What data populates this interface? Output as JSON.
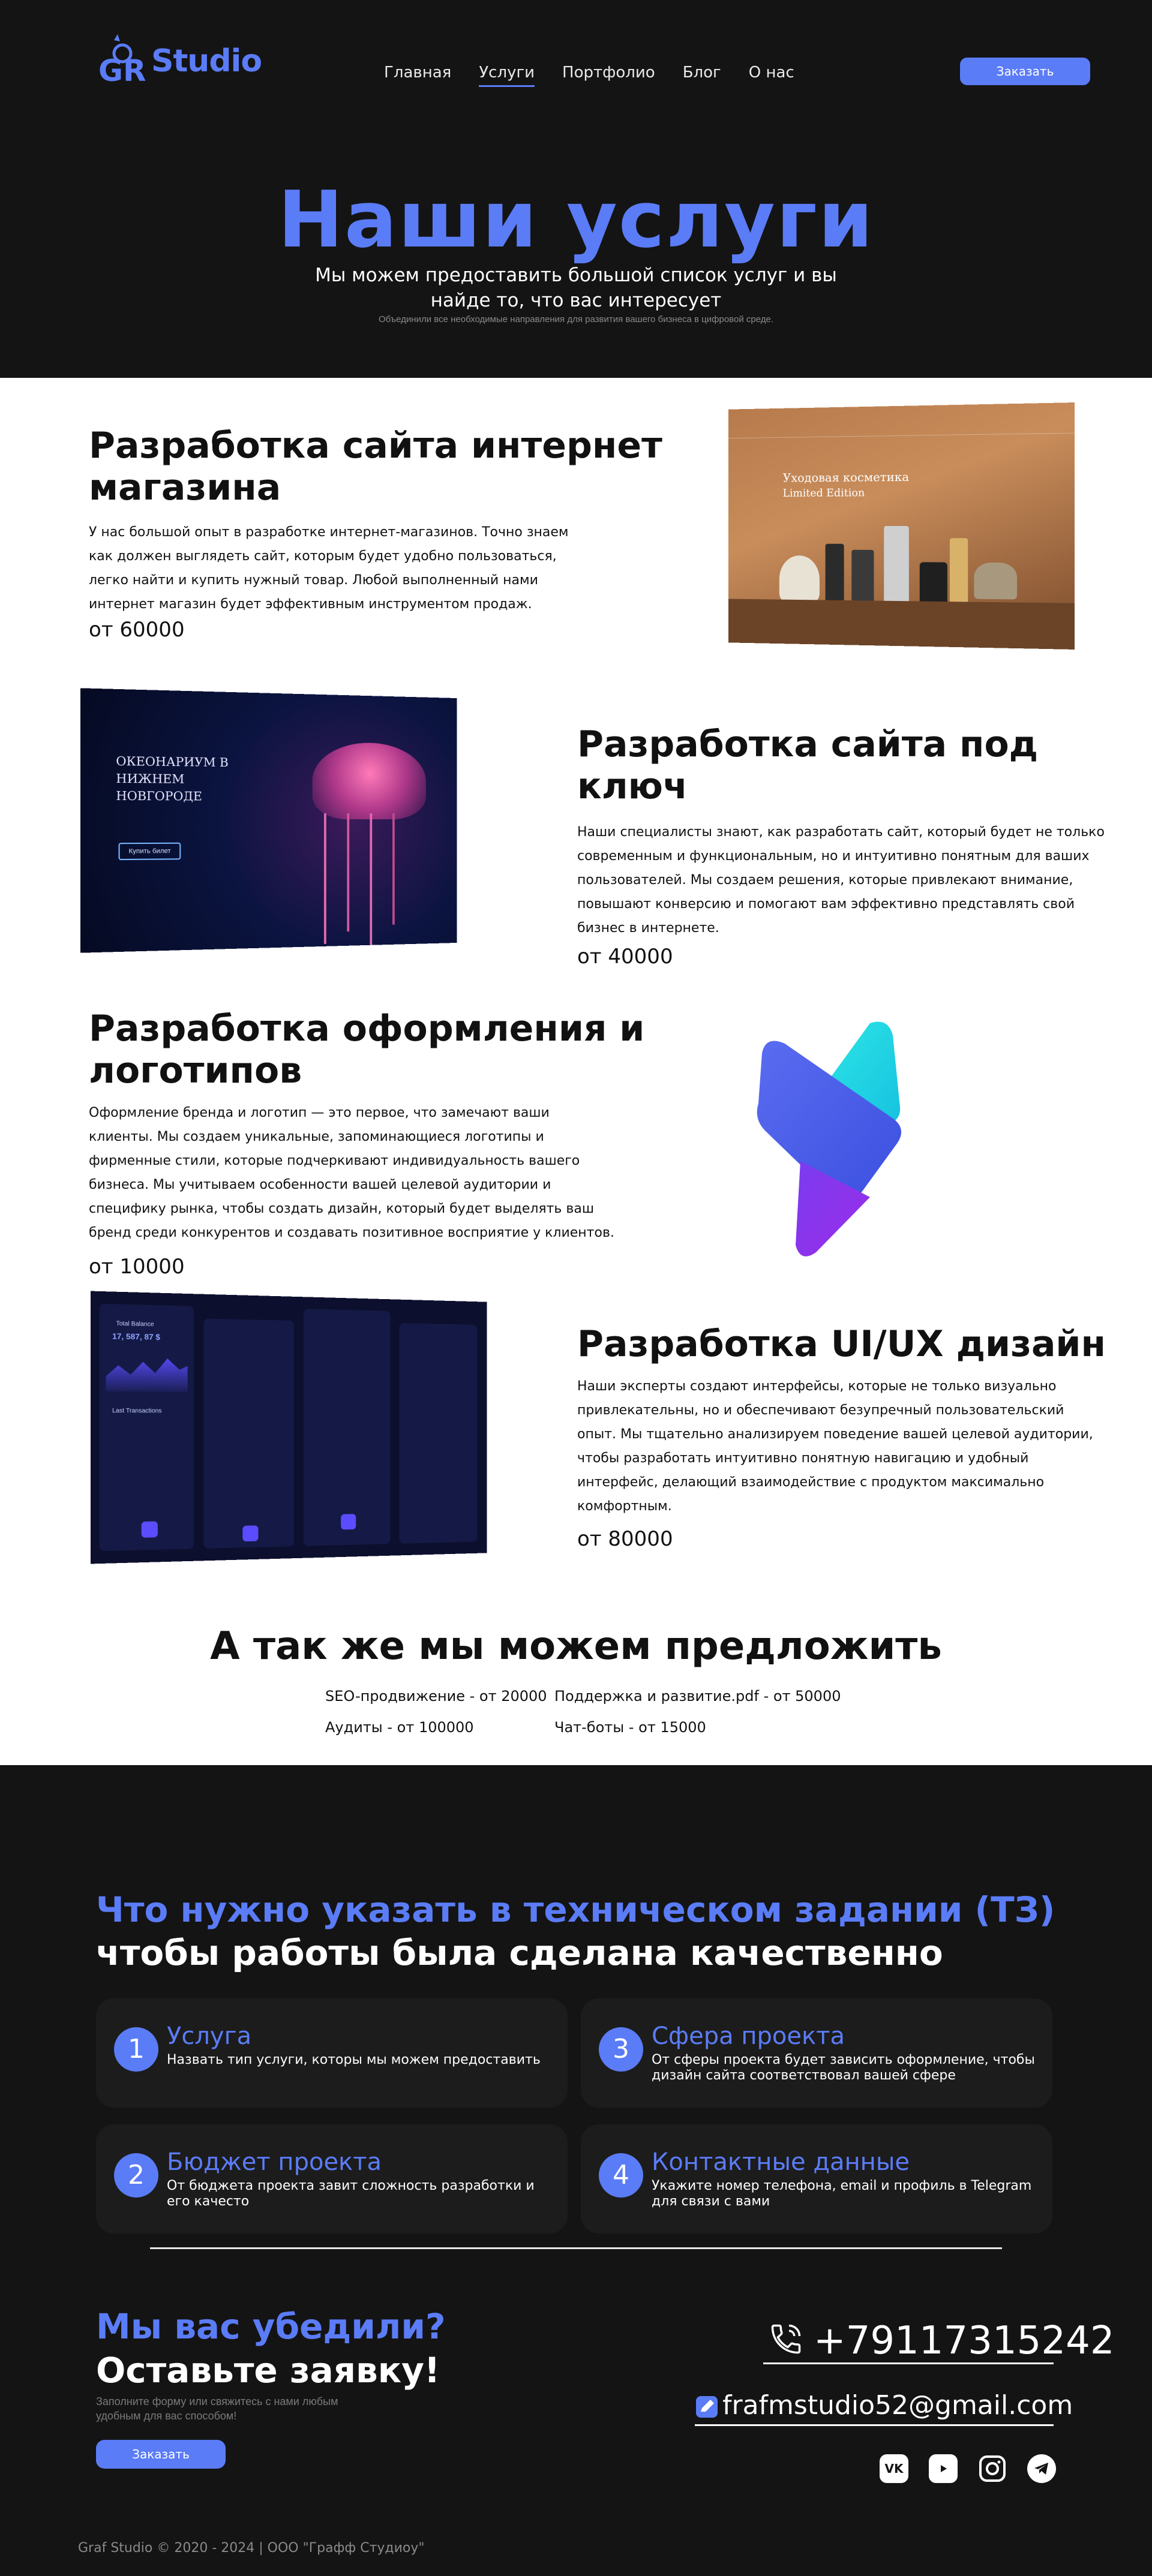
{
  "header": {
    "logo_text": "Studio",
    "logo_letters": "GR",
    "nav": [
      "Главная",
      "Услуги",
      "Портфолио",
      "Блог",
      "О нас"
    ],
    "order_label": "Заказать"
  },
  "hero": {
    "title": "Наши услуги",
    "subtitle": "Мы можем предоставить большой список услуг и вы найде то, что вас интересует",
    "note": "Объединили все необходимые направления для развития вашего бизнеса в цифровой среде."
  },
  "services": [
    {
      "title": "Разработка сайта интернет магазина",
      "description": "У нас большой опыт в разработке интернет-магазинов. Точно знаем как должен выглядеть сайт, которым будет удобно пользоваться, легко найти и купить нужный товар. Любой выполненный нами интернет магазин будет эффективным инструментом продаж.",
      "price": "от 60000"
    },
    {
      "title": "Разработка сайта под ключ",
      "description": "Наши специалисты знают, как разработать сайт, который будет не только современным и функциональным, но и интуитивно понятным для ваших пользователей. Мы создаем решения, которые привлекают внимание, повышают конверсию и помогают вам эффективно представлять свой бизнес в интернете.",
      "price": "от 40000"
    },
    {
      "title": "Разработка оформления и логотипов",
      "description": "Оформление бренда и логотип — это первое, что замечают ваши клиенты. Мы создаем уникальные, запоминающиеся логотипы и фирменные стили, которые подчеркивают индивидуальность вашего бизнеса. Мы учитываем особенности вашей целевой аудитории и специфику рынка, чтобы создать дизайн, который будет выделять ваш бренд среди конкурентов и создавать позитивное восприятие у клиентов.",
      "price": "от 10000"
    },
    {
      "title": "Разработка UI/UX дизайн",
      "description": "Наши эксперты создают интерфейсы, которые не только визуально привлекательны, но и обеспечивают безупречный пользовательский опыт. Мы тщательно анализируем поведение вашей целевой аудитории, чтобы разработать интуитивно понятную навигацию и удобный интерфейс, делающий взаимодействие с продуктом максимально комфортным.",
      "price": "от 80000"
    }
  ],
  "mockups": {
    "shop_heading": "Уходовая косметика",
    "shop_sub": "Limited Edition",
    "jelly_heading": "ОКЕОНАРИУМ В НИЖНЕМ НОВГОРОДЕ",
    "jelly_button": "Купить билет",
    "uiux_balance_label": "Total Balance",
    "uiux_balance": "17, 587, 87 $",
    "uiux_list_title": "Last Transactions"
  },
  "extra": {
    "title": "А так же мы можем предложить",
    "items": [
      "SEO-продвижение - от 20000",
      "Поддержка и развитие.pdf - от 50000",
      "Аудиты - от 100000",
      "Чат-боты - от 15000"
    ]
  },
  "tz": {
    "title_accent": "Что нужно указать в техническом задании (ТЗ)",
    "title_plain": "чтобы работы была сделана качественно",
    "cards": [
      {
        "num": "1",
        "title": "Услуга",
        "desc": "Назвать тип услуги, которы мы можем предоставить"
      },
      {
        "num": "3",
        "title": "Сфера проекта",
        "desc": "От сферы проекта будет зависить оформление, чтобы дизайн сайта соответствовал вашей сфере"
      },
      {
        "num": "2",
        "title": "Бюджет проекта",
        "desc": "От бюджета проекта завит сложность разработки и его качесто"
      },
      {
        "num": "4",
        "title": "Контактные данные",
        "desc": "Укажите номер телефона, email и профиль в Telegram для связи с вами"
      }
    ]
  },
  "cta": {
    "title_accent": "Мы вас убедили?",
    "title_plain": "Оставьте заявку!",
    "note": "Заполните форму или свяжитесь с нами любым удобным для вас способом!",
    "order_label": "Заказать",
    "phone": "+79117315242",
    "email": "frafmstudio52@gmail.com",
    "socials": [
      "vk-icon",
      "youtube-icon",
      "instagram-icon",
      "telegram-icon"
    ],
    "vk_label": "VK"
  },
  "footer": {
    "copyright": "Graf Studio © 2020 - 2024 | ООО \"Графф Студиоу\""
  },
  "colors": {
    "accent": "#5b7cf7",
    "dark_bg": "#141414",
    "card_bg": "#1c1c1c"
  }
}
